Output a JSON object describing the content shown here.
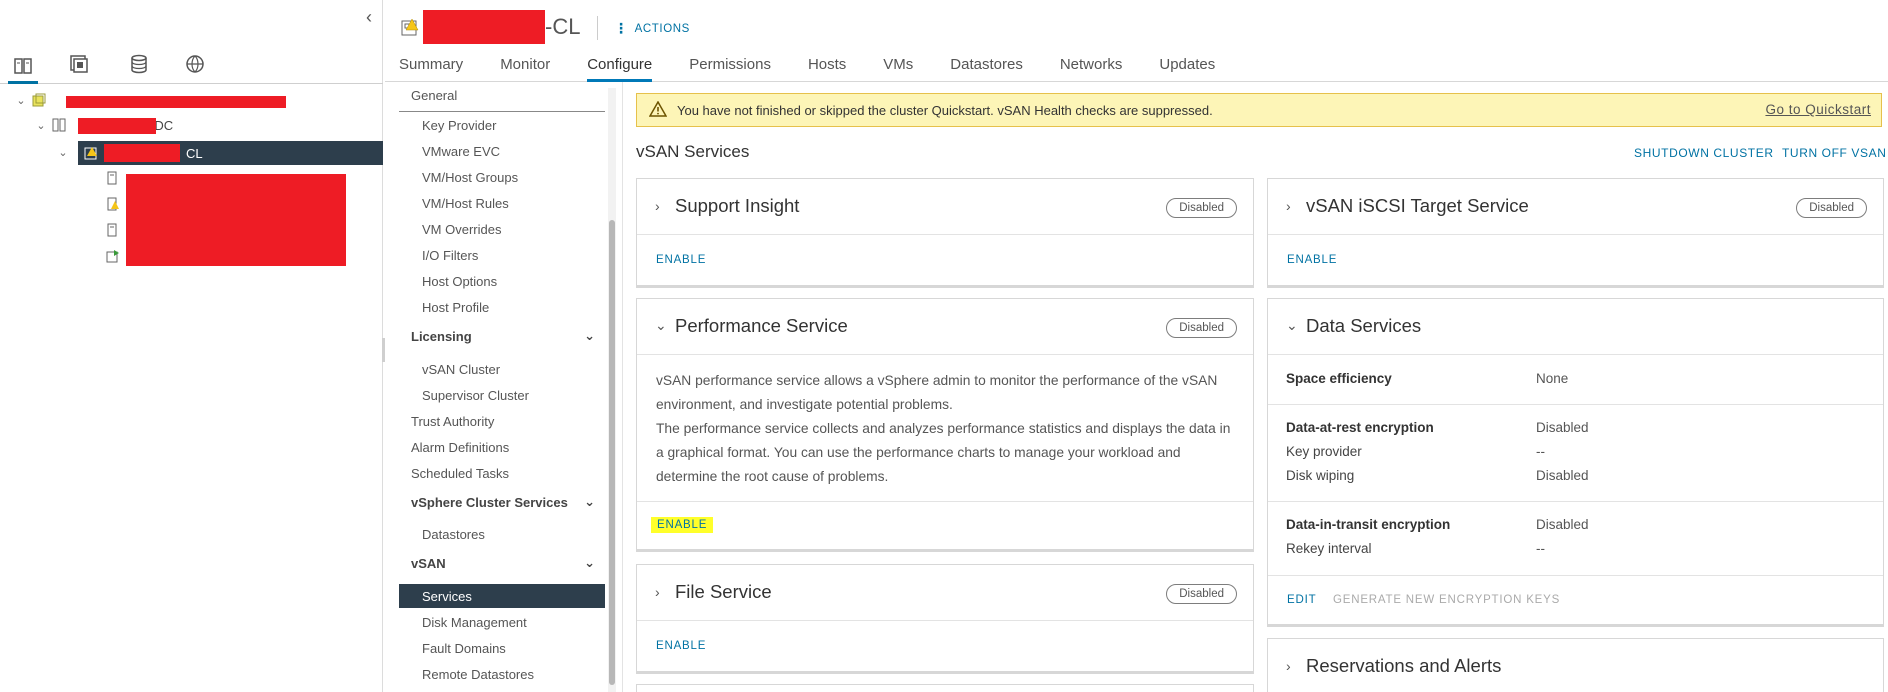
{
  "navigator": {
    "collapse_icon": "chevron-left-icon",
    "tabs": [
      "hosts-and-clusters-icon",
      "vms-and-templates-icon",
      "storage-icon",
      "networking-icon"
    ],
    "tree": {
      "datacenter_suffix": "-DC",
      "cluster_suffix": "CL"
    }
  },
  "header": {
    "title_suffix": "-CL",
    "actions_label": "ACTIONS",
    "tabs": [
      "Summary",
      "Monitor",
      "Configure",
      "Permissions",
      "Hosts",
      "VMs",
      "Datastores",
      "Networks",
      "Updates"
    ],
    "active_tab": "Configure"
  },
  "configure_menu": {
    "items": [
      {
        "label": "General",
        "kind": "top"
      },
      {
        "label": "Key Provider",
        "kind": "sub"
      },
      {
        "label": "VMware EVC",
        "kind": "sub"
      },
      {
        "label": "VM/Host Groups",
        "kind": "sub"
      },
      {
        "label": "VM/Host Rules",
        "kind": "sub"
      },
      {
        "label": "VM Overrides",
        "kind": "sub"
      },
      {
        "label": "I/O Filters",
        "kind": "sub"
      },
      {
        "label": "Host Options",
        "kind": "sub"
      },
      {
        "label": "Host Profile",
        "kind": "sub"
      },
      {
        "label": "Licensing",
        "kind": "group"
      },
      {
        "label": "vSAN Cluster",
        "kind": "sub"
      },
      {
        "label": "Supervisor Cluster",
        "kind": "sub"
      },
      {
        "label": "Trust Authority",
        "kind": "top"
      },
      {
        "label": "Alarm Definitions",
        "kind": "top"
      },
      {
        "label": "Scheduled Tasks",
        "kind": "top"
      },
      {
        "label": "vSphere Cluster Services",
        "kind": "group"
      },
      {
        "label": "Datastores",
        "kind": "sub"
      },
      {
        "label": "vSAN",
        "kind": "group"
      },
      {
        "label": "Services",
        "kind": "sub",
        "selected": true
      },
      {
        "label": "Disk Management",
        "kind": "sub"
      },
      {
        "label": "Fault Domains",
        "kind": "sub"
      },
      {
        "label": "Remote Datastores",
        "kind": "sub"
      }
    ]
  },
  "alert": {
    "text": "You have not finished or skipped the cluster Quickstart. vSAN Health checks are suppressed.",
    "link": "Go to Quickstart",
    "color": "#fdf5b7"
  },
  "main": {
    "section_title": "vSAN Services",
    "shutdown_label": "SHUTDOWN CLUSTER",
    "turn_off_label": "TURN OFF VSAN",
    "support_insight": {
      "title": "Support Insight",
      "status": "Disabled",
      "action": "ENABLE"
    },
    "iscsi": {
      "title": "vSAN iSCSI Target Service",
      "status": "Disabled",
      "action": "ENABLE"
    },
    "performance": {
      "title": "Performance Service",
      "status": "Disabled",
      "desc_1": "vSAN performance service allows a vSphere admin to monitor the performance of the vSAN environment, and investigate potential problems.",
      "desc_2": "The performance service collects and analyzes performance statistics and displays the data in a graphical format. You can use the performance charts to manage your workload and determine the root cause of problems.",
      "action": "ENABLE"
    },
    "file_service": {
      "title": "File Service",
      "status": "Disabled",
      "action": "ENABLE"
    },
    "data_services": {
      "title": "Data Services",
      "space_efficiency_label": "Space efficiency",
      "space_efficiency_value": "None",
      "dare_label": "Data-at-rest encryption",
      "dare_value": "Disabled",
      "key_provider_label": "Key provider",
      "key_provider_value": "--",
      "disk_wiping_label": "Disk wiping",
      "disk_wiping_value": "Disabled",
      "dit_label": "Data-in-transit encryption",
      "dit_value": "Disabled",
      "rekey_label": "Rekey interval",
      "rekey_value": "--",
      "edit_label": "EDIT",
      "generate_label": "GENERATE NEW ENCRYPTION KEYS"
    },
    "reservations": {
      "title": "Reservations and Alerts"
    }
  }
}
